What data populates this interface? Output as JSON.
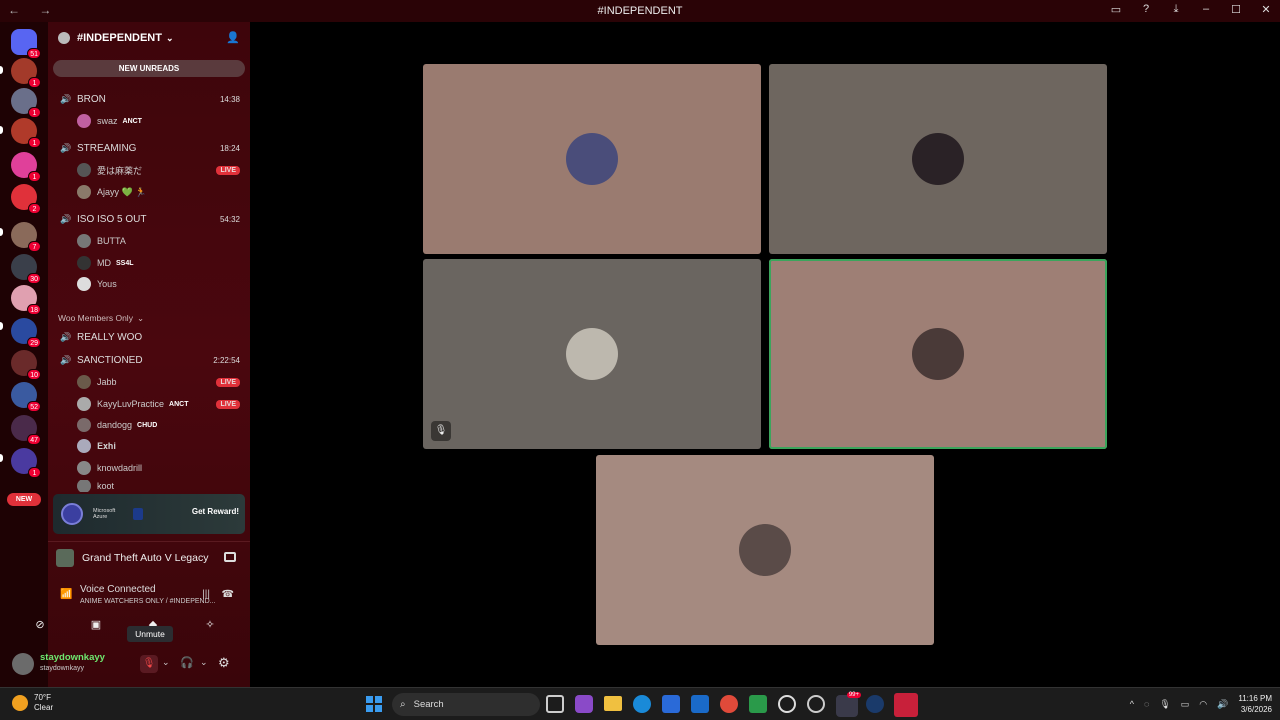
{
  "window": {
    "title": "#INDEPENDENT",
    "nav": "← →"
  },
  "titlebar_icons": [
    "screen-share-icon",
    "help-icon",
    "download-icon",
    "minimize-icon",
    "maximize-icon",
    "close-icon"
  ],
  "server": {
    "name": "#INDEPENDENT",
    "new_unreads": "NEW UNREADS"
  },
  "guild_badges": [
    "51",
    "1",
    "1",
    "1",
    "1",
    "2",
    "7",
    "30",
    "18",
    "29",
    "10",
    "52",
    "47",
    "1"
  ],
  "guild_new": "NEW",
  "channels": [
    {
      "name": "BRON",
      "time": "14:38",
      "users": [
        {
          "name": "swaz",
          "tag": "ANCT"
        }
      ]
    },
    {
      "name": "STREAMING",
      "time": "18:24",
      "users": [
        {
          "name": "愛は麻薬だ",
          "live": "LIVE"
        },
        {
          "name": "Ajayy 💚 🏃"
        }
      ]
    },
    {
      "name": "ISO ISO 5 OUT",
      "time": "54:32",
      "users": [
        {
          "name": "BUTTA"
        },
        {
          "name": "MD",
          "tag": "SS4L"
        },
        {
          "name": "Yous"
        }
      ]
    }
  ],
  "category": "Woo Members Only",
  "channels2": [
    {
      "name": "REALLY WOO"
    },
    {
      "name": "SANCTIONED",
      "time": "2:22:54",
      "users": [
        {
          "name": "Jabb",
          "live": "LIVE"
        },
        {
          "name": "KayyLuvPractice",
          "tag": "ANCT",
          "live": "LIVE"
        },
        {
          "name": "dandogg",
          "tag": "CHUD"
        },
        {
          "name": "𝐄𝐱𝐡𝐢"
        },
        {
          "name": "knowdadrill"
        },
        {
          "name": "koot"
        }
      ]
    }
  ],
  "promo": {
    "brand": "Microsoft Azure",
    "cta": "Get Reward!"
  },
  "activity": {
    "game": "Grand Theft Auto V Legacy"
  },
  "voice": {
    "status": "Voice Connected",
    "channel": "ANIME WATCHERS ONLY / #INDEPEND..."
  },
  "tooltip": "Unmute",
  "user": {
    "display_name": "staydownkayy",
    "username": "staydownkayy"
  },
  "tiles": [
    {
      "bg": "#9a7b70",
      "avatar": "#4a4d7a",
      "speaking": false,
      "muted": false
    },
    {
      "bg": "#6e665f",
      "avatar": "#2a2226",
      "speaking": false,
      "muted": false
    },
    {
      "bg": "#6a6560",
      "avatar": "#bdb8ae",
      "speaking": false,
      "muted": true
    },
    {
      "bg": "#9e7f75",
      "avatar": "#4a3a38",
      "speaking": true,
      "muted": false
    },
    {
      "bg": "#a58a80",
      "avatar": "#5a4b48",
      "speaking": false,
      "muted": false
    }
  ],
  "taskbar": {
    "weather_temp": "70°F",
    "weather_desc": "Clear",
    "search": "Search",
    "time": "11:16 PM",
    "date": "3/6/2026",
    "discord_badge": "99+"
  },
  "colors": {
    "accent": "#3ba55c",
    "live": "#e0313a",
    "sidebar": "#4a070e"
  }
}
